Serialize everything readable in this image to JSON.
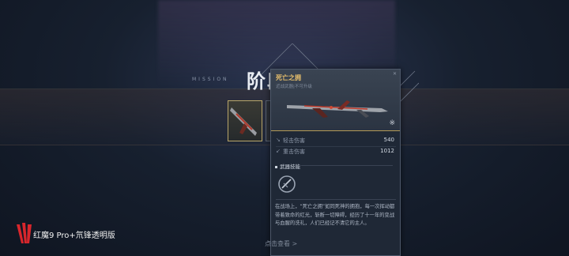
{
  "stage": {
    "title": "阶段",
    "subtitle": "MISSION"
  },
  "tooltip": {
    "name": "死亡之拥",
    "subtitle": "近战武器|不可升级",
    "corner": "✕",
    "emblem": "※",
    "stats": [
      {
        "icon": "light-attack-icon",
        "label": "轻击伤害",
        "value": "540"
      },
      {
        "icon": "heavy-attack-icon",
        "label": "重击伤害",
        "value": "1012"
      }
    ],
    "skill_header": "武器技能",
    "skill_icon": "slash-skill-icon",
    "description": "在战场上，“死亡之拥”如同死神的拥抱，每一次挥动都带着致命的红光，斩断一切障碍，经历了十一年的变战与血腥的洗礼，人们已经记不清它的主人。"
  },
  "bottom_label": "点击查看 >",
  "brand": {
    "text": "红魔9 Pro+氘锋透明版",
    "logo": "red-magic-logo"
  },
  "colors": {
    "accent_gold": "#e8c06c",
    "card_bg": "#1f2836",
    "border_gold": "#b49a56"
  }
}
